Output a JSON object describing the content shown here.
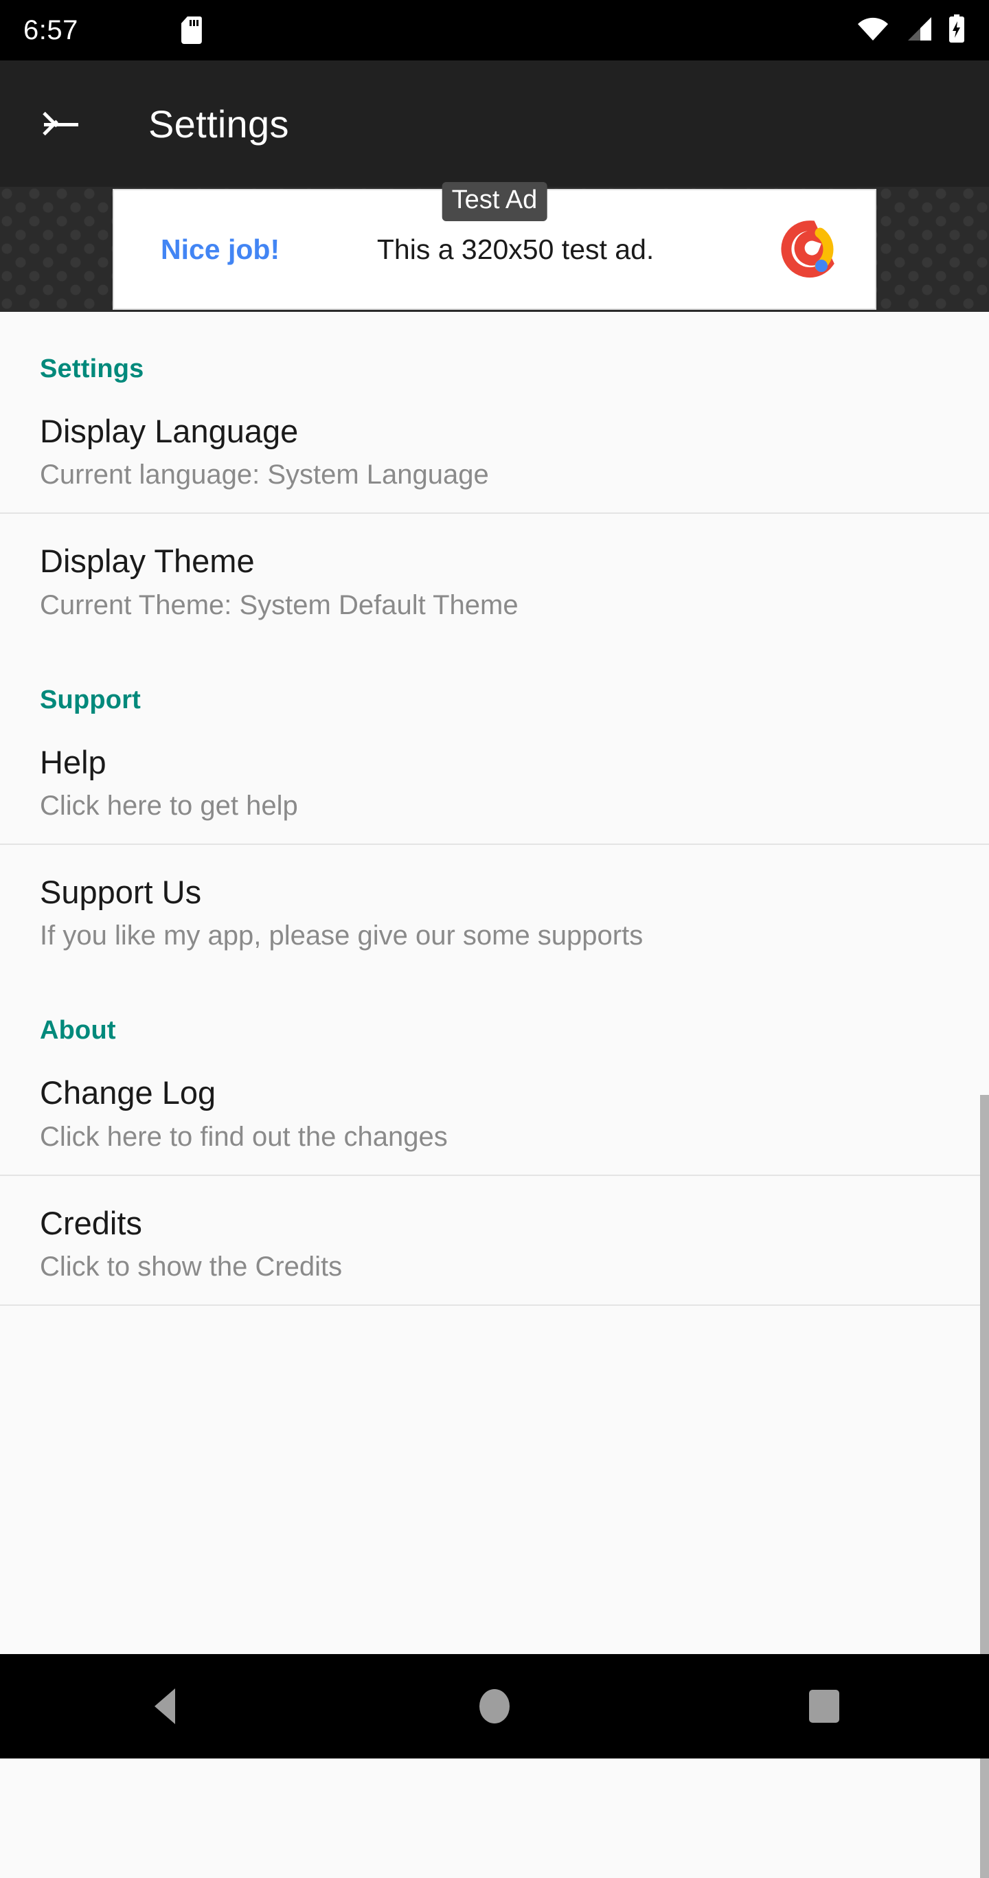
{
  "status_bar": {
    "clock": "6:57",
    "icons": [
      "sd-card-icon",
      "wifi-icon",
      "cellular-signal-icon",
      "battery-charging-icon"
    ]
  },
  "app_bar": {
    "back_label": "back-arrow-icon",
    "title": "Settings"
  },
  "ad": {
    "cta": "Nice job!",
    "body": "This a 320x50 test ad.",
    "badge": "Test Ad",
    "logo": "admob-logo"
  },
  "colors": {
    "status_bar_bg": "#000000",
    "app_bar_bg": "#212121",
    "page_bg": "#FAFAFA",
    "section_accent": "#00897B",
    "title_text": "#1A1A1A",
    "summary_text": "#8A8A8A",
    "divider": "#E4E4E4",
    "ad_cta": "#4285F4",
    "nav_icon": "#9E9E9E",
    "scrollbar": "#B3B3B3"
  },
  "sections": [
    {
      "header": "Settings",
      "items": [
        {
          "title": "Display Language",
          "summary": "Current language: System Language"
        },
        {
          "title": "Display Theme",
          "summary": "Current Theme: System Default Theme"
        }
      ]
    },
    {
      "header": "Support",
      "items": [
        {
          "title": "Help",
          "summary": "Click here to get help"
        },
        {
          "title": "Support Us",
          "summary": "If you like my app, please give our some supports"
        }
      ]
    },
    {
      "header": "About",
      "items": [
        {
          "title": "Change Log",
          "summary": "Click here to find out the changes"
        },
        {
          "title": "Credits",
          "summary": "Click to show the Credits"
        }
      ]
    }
  ],
  "nav_bar": {
    "back": "nav-back-icon",
    "home": "nav-home-icon",
    "recents": "nav-recents-icon"
  }
}
